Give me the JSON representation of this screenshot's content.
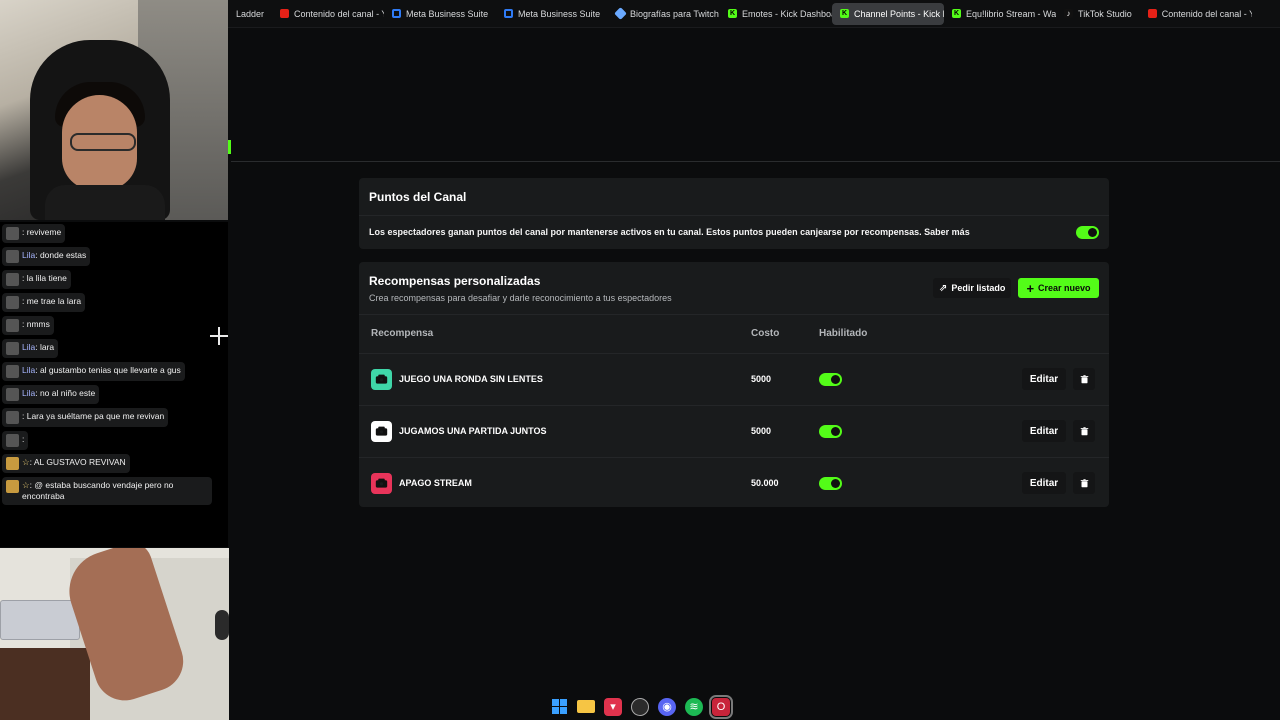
{
  "browser": {
    "tabs": [
      {
        "label": "Ladder",
        "icon": "none",
        "active": false
      },
      {
        "label": "Contenido del canal - Yo",
        "icon": "youtube-icon",
        "active": false
      },
      {
        "label": "Meta Business Suite",
        "icon": "meta-icon",
        "active": false
      },
      {
        "label": "Meta Business Suite",
        "icon": "meta-icon",
        "active": false
      },
      {
        "label": "Biografías para Twitch y",
        "icon": "sparkle-icon",
        "active": false
      },
      {
        "label": "Emotes - Kick Dashboar",
        "icon": "kick-icon",
        "active": false
      },
      {
        "label": "Channel Points - Kick Das",
        "icon": "kick-icon",
        "active": true
      },
      {
        "label": "Equ!librio Stream - Wat",
        "icon": "kick-icon",
        "active": false
      },
      {
        "label": "TikTok Studio",
        "icon": "tiktok-icon",
        "active": false
      },
      {
        "label": "Contenido del canal - Yo",
        "icon": "youtube-icon",
        "active": false
      }
    ]
  },
  "chat": {
    "messages": [
      {
        "user": "",
        "text": ": reviveme"
      },
      {
        "user": "Lila",
        "text": ": donde estas"
      },
      {
        "user": "",
        "text": ": la lila tiene"
      },
      {
        "user": "",
        "text": ": me trae la lara"
      },
      {
        "user": "",
        "text": ": nmms"
      },
      {
        "user": "Lila",
        "text": ": lara"
      },
      {
        "user": "Lila",
        "text": ": al gustambo tenias que llevarte a gus"
      },
      {
        "user": "Lila",
        "text": ": no al niño este"
      },
      {
        "user": "",
        "text": ": Lara ya suéltame pa que me revivan"
      },
      {
        "user": "",
        "text": ":"
      },
      {
        "user": "☆",
        "text": ": AL GUSTAVO REVIVAN"
      },
      {
        "user": "☆",
        "text": ": @ estaba buscando vendaje pero no encontraba"
      }
    ]
  },
  "points": {
    "title": "Puntos del Canal",
    "description": "Los espectadores ganan puntos del canal por mantenerse activos en tu canal. Estos puntos pueden canjearse por recompensas. Saber más",
    "enabled": true
  },
  "rewards": {
    "title": "Recompensas personalizadas",
    "subtitle": "Crea recompensas para desafiar y darle reconocimiento a tus espectadores",
    "request_list_label": "Pedir listado",
    "create_label": "Crear nuevo",
    "columns": {
      "name": "Recompensa",
      "cost": "Costo",
      "enabled": "Habilitado"
    },
    "rows": [
      {
        "name": "JUEGO UNA RONDA SIN LENTES",
        "cost": "5000",
        "enabled": true,
        "color": "#3fd6a8",
        "edit_label": "Editar"
      },
      {
        "name": "JUGAMOS UNA PARTIDA JUNTOS",
        "cost": "5000",
        "enabled": true,
        "color": "#ffffff",
        "edit_label": "Editar"
      },
      {
        "name": "APAGO STREAM",
        "cost": "50.000",
        "enabled": true,
        "color": "#e8345a",
        "edit_label": "Editar"
      }
    ]
  },
  "colors": {
    "accent": "#53fc18",
    "card": "#191b1c",
    "background": "#0b0c0d"
  },
  "taskbar": {
    "icons": [
      "windows-start-icon",
      "file-explorer-icon",
      "red-app-icon",
      "browser-icon",
      "discord-icon",
      "spotify-icon",
      "opera-gx-icon"
    ]
  }
}
